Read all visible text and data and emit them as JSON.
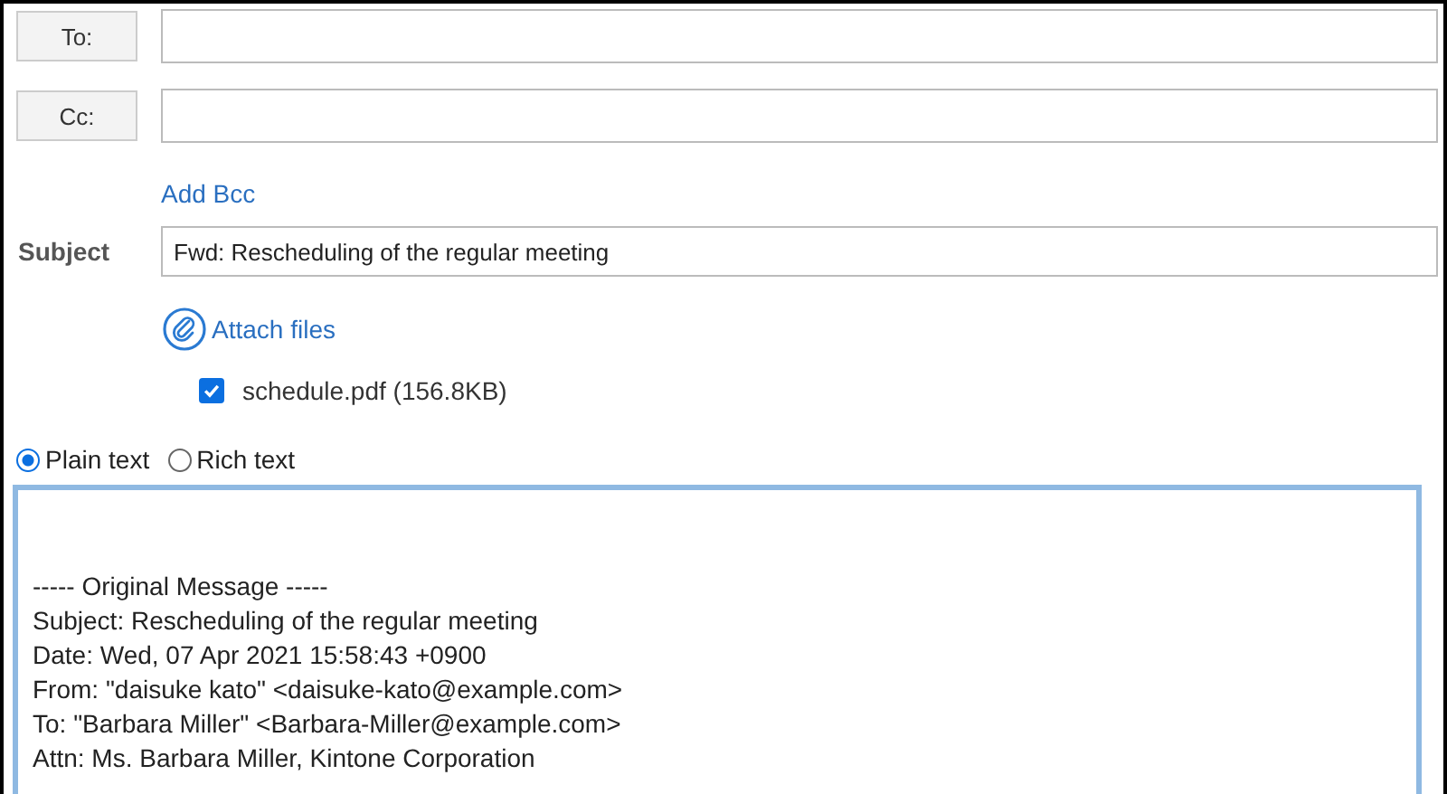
{
  "recipients": [
    {
      "button": "To:"
    },
    {
      "button": "Cc:"
    }
  ],
  "add_bcc": "Add Bcc",
  "subject": {
    "label": "Subject",
    "value": "Fwd: Rescheduling of the regular meeting"
  },
  "attach": {
    "label": "Attach files"
  },
  "attachments": [
    {
      "name": "schedule.pdf (156.8KB)",
      "checked": true
    }
  ],
  "formats": [
    {
      "label": "Plain text",
      "selected": true
    },
    {
      "label": "Rich text",
      "selected": false
    }
  ],
  "body_lines": [
    "----- Original Message -----",
    "Subject: Rescheduling of the regular meeting",
    "Date: Wed, 07 Apr 2021 15:58:43 +0900",
    "From: \"daisuke kato\" <daisuke-kato@example.com>",
    "To: \"Barbara Miller\" <Barbara-Miller@example.com>",
    "Attn: Ms. Barbara Miller, Kintone Corporation"
  ]
}
